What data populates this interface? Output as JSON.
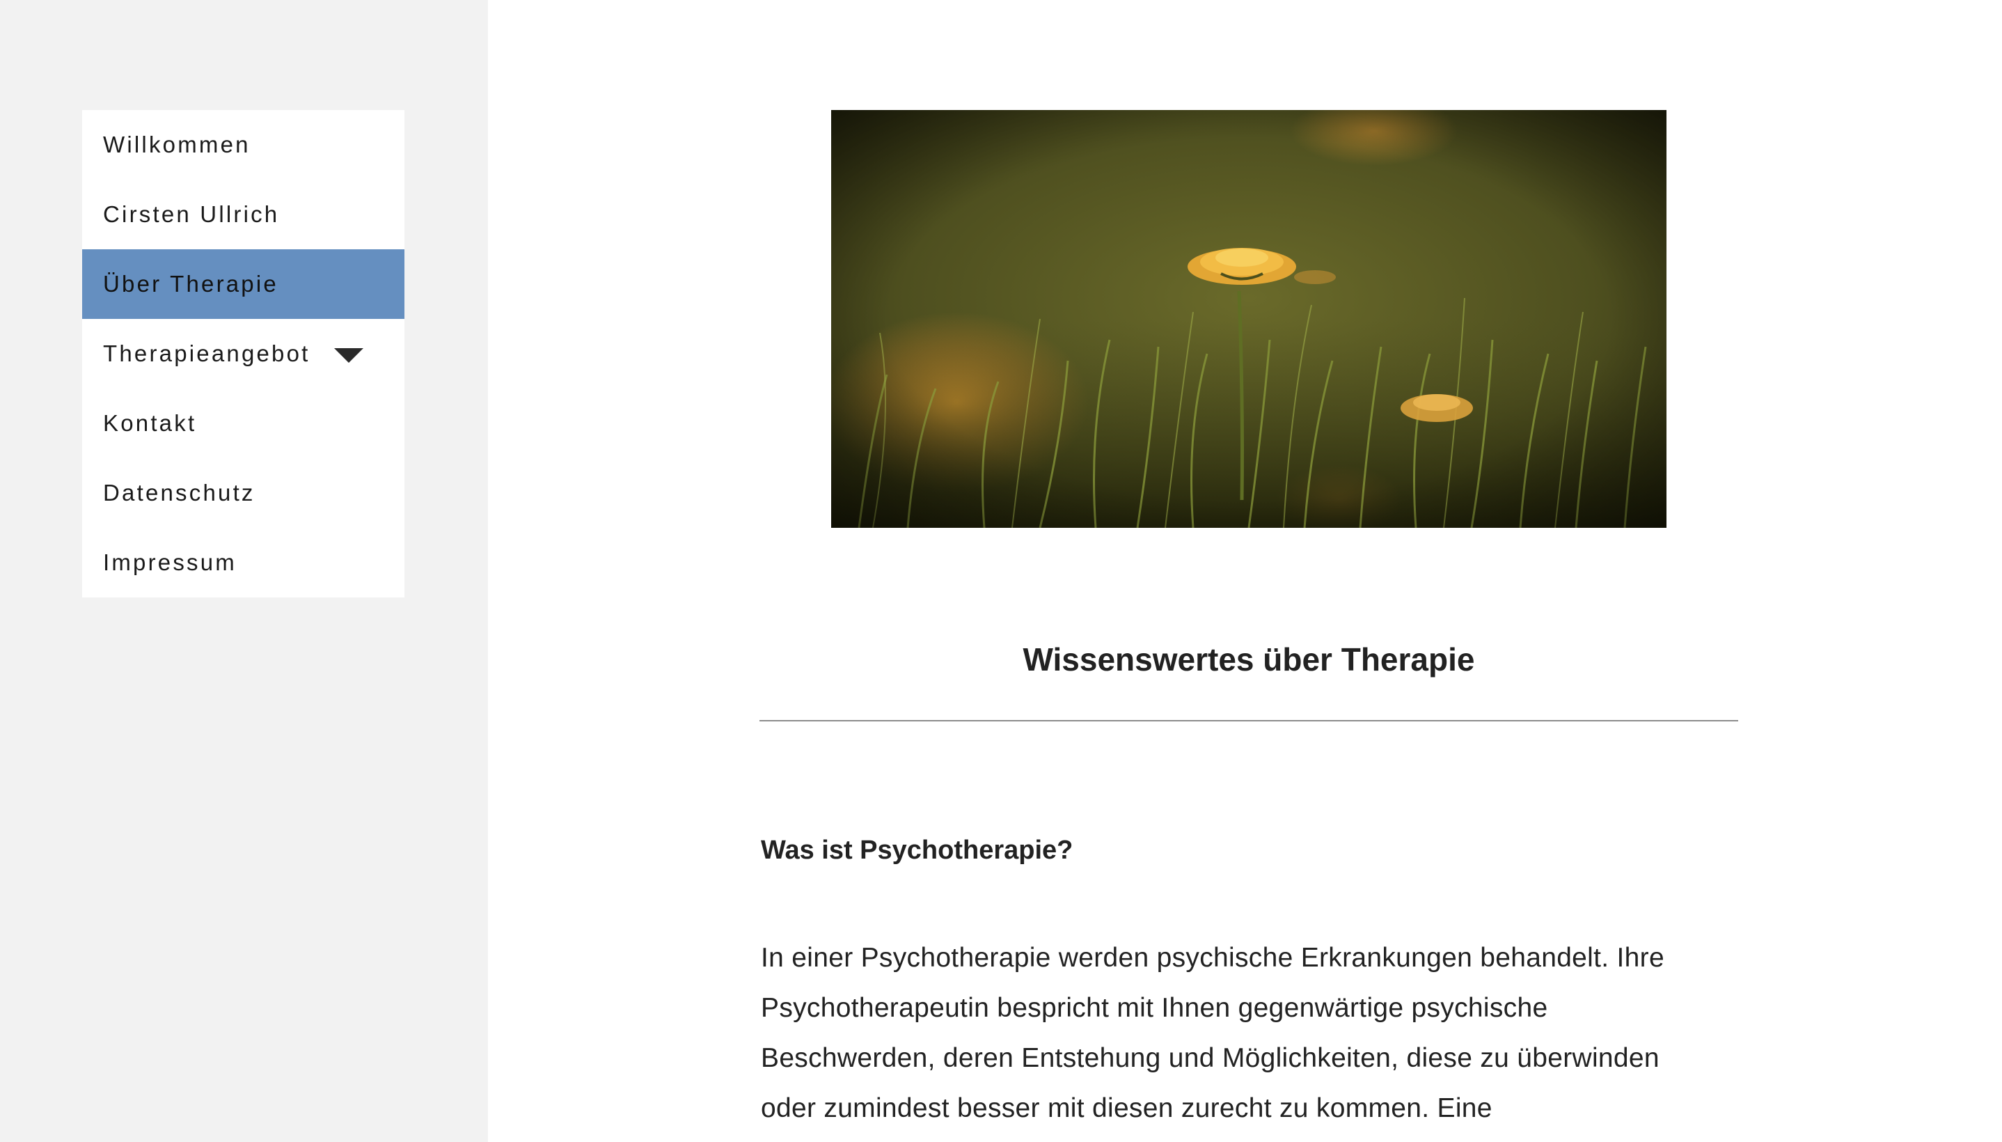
{
  "nav": {
    "items": [
      {
        "label": "Willkommen",
        "active": false
      },
      {
        "label": "Cirsten Ullrich",
        "active": false
      },
      {
        "label": "Über Therapie",
        "active": true
      },
      {
        "label": "Therapieangebot",
        "active": false,
        "has_dropdown": true
      },
      {
        "label": "Kontakt",
        "active": false
      },
      {
        "label": "Datenschutz",
        "active": false
      },
      {
        "label": "Impressum",
        "active": false
      }
    ],
    "dropdown_icon": "caret-down-icon"
  },
  "colors": {
    "sidebar_bg": "#f2f2f2",
    "active_item_bg": "#658fc0",
    "text": "#222222",
    "divider": "#8c8c8c"
  },
  "hero": {
    "subject": "dandelion-in-grass-photo"
  },
  "content": {
    "heading": "Wissenswertes über Therapie",
    "question": "Was ist Psychotherapie?",
    "paragraph_lines": [
      "In einer Psychotherapie werden psychische Erkrankungen behandelt. Ihre",
      "Psychotherapeutin bespricht mit Ihnen gegenwärtige psychische",
      "Beschwerden, deren Entstehung und Möglichkeiten, diese zu überwinden",
      "oder zumindest besser mit diesen zurecht zu kommen. Eine"
    ]
  }
}
